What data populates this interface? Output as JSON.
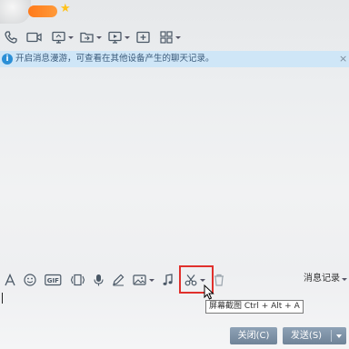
{
  "header": {
    "star_icon": "star-icon",
    "toolbar": [
      {
        "name": "phone-call",
        "icon": "phone-icon",
        "dropdown": false
      },
      {
        "name": "video-call",
        "icon": "video-camera-icon",
        "dropdown": false
      },
      {
        "name": "remote-desktop",
        "icon": "screen-share-icon",
        "dropdown": true
      },
      {
        "name": "send-file",
        "icon": "folder-send-icon",
        "dropdown": true
      },
      {
        "name": "remote-assist",
        "icon": "monitor-icon",
        "dropdown": true
      },
      {
        "name": "add-friend-to-chat",
        "icon": "plus-square-icon",
        "dropdown": false
      },
      {
        "name": "apps",
        "icon": "grid-icon",
        "dropdown": true
      }
    ]
  },
  "infobar": {
    "text": "开启消息漫游，可查看在其他设备产生的聊天记录。",
    "info_icon": "i",
    "close": "×",
    "color": "#cfe6f7"
  },
  "input_toolbar": {
    "items": [
      {
        "name": "font",
        "icon": "font-icon"
      },
      {
        "name": "emoji",
        "icon": "smiley-icon"
      },
      {
        "name": "gif",
        "icon": "gif-icon",
        "label": "GIF"
      },
      {
        "name": "shake-window",
        "icon": "shake-icon"
      },
      {
        "name": "voice-message",
        "icon": "microphone-icon"
      },
      {
        "name": "doodle",
        "icon": "pencil-icon"
      },
      {
        "name": "send-image",
        "icon": "image-icon"
      },
      {
        "name": "music",
        "icon": "music-note-icon"
      },
      {
        "name": "screenshot",
        "icon": "scissors-icon"
      },
      {
        "name": "delete-history",
        "icon": "trash-icon"
      }
    ],
    "message_record_label": "消息记录"
  },
  "tooltip": {
    "text": "屏幕截图 Ctrl + Alt + A"
  },
  "buttons": {
    "close_label": "关闭(C)",
    "send_label": "发送(S)"
  },
  "colors": {
    "highlight": "#e0302c",
    "button": "#7f93a8",
    "accent": "#2b8fd6"
  }
}
